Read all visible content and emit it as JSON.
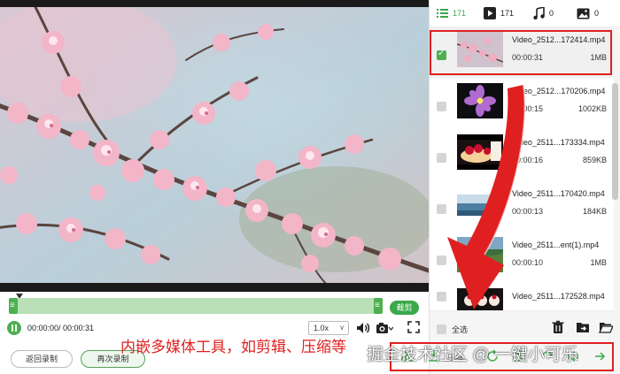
{
  "tabs": [
    {
      "icon": "list-icon",
      "count": "171",
      "active": true
    },
    {
      "icon": "video-icon",
      "count": "171",
      "active": false
    },
    {
      "icon": "music-icon",
      "count": "0",
      "active": false
    },
    {
      "icon": "image-icon",
      "count": "0",
      "active": false
    }
  ],
  "files": [
    {
      "name": "Video_2512...172414.mp4",
      "duration": "00:00:31",
      "size": "1MB",
      "checked": true,
      "thumb": "blossom"
    },
    {
      "name": "Video_2512...170206.mp4",
      "duration": "00:00:15",
      "size": "1002KB",
      "checked": false,
      "thumb": "purple-flower"
    },
    {
      "name": "Video_2511...173334.mp4",
      "duration": "00:00:16",
      "size": "859KB",
      "checked": false,
      "thumb": "cake"
    },
    {
      "name": "Video_2511...170420.mp4",
      "duration": "00:00:13",
      "size": "184KB",
      "checked": false,
      "thumb": "sea"
    },
    {
      "name": "Video_2511...ent(1).mp4",
      "duration": "00:00:10",
      "size": "1MB",
      "checked": false,
      "thumb": "field"
    },
    {
      "name": "Video_2511...172528.mp4",
      "duration": "",
      "size": "",
      "checked": false,
      "thumb": "dessert"
    }
  ],
  "player": {
    "time": "00:00:00/ 00:00:31",
    "speed": "1.0x",
    "trim_label": "裁剪",
    "progress": 0.02
  },
  "buttons": {
    "back": "返回录制",
    "again": "再次录制"
  },
  "sidebar_footer": {
    "select_all": "全选"
  },
  "caption": "内嵌多媒体工具，如剪辑、压缩等",
  "watermark": "掘金技术社区 @ 一键小可乐",
  "toolbar_label": "压缩",
  "colors": {
    "accent": "#4caf50",
    "highlight": "#e02020"
  }
}
